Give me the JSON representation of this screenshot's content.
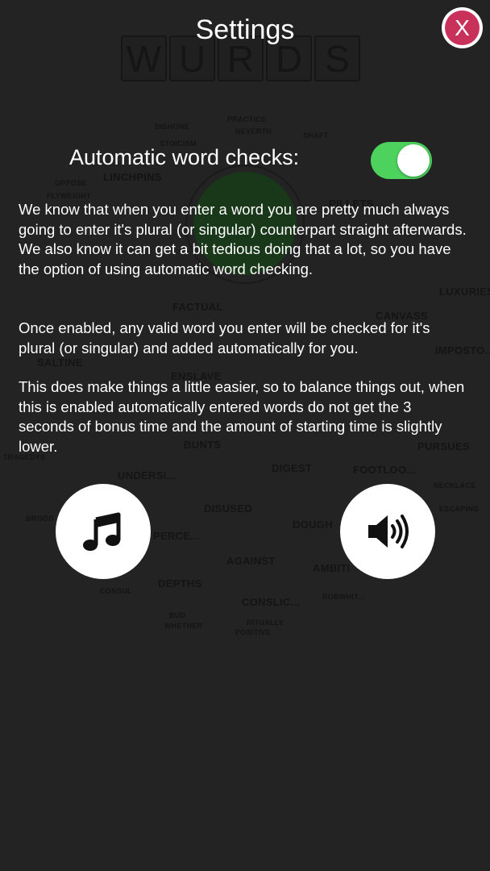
{
  "header": {
    "title": "Settings",
    "close_label": "X"
  },
  "background": {
    "logo_letters": [
      "W",
      "U",
      "R",
      "D",
      "S"
    ],
    "words": [
      "DISHONE",
      "STOICISM",
      "NEVERTH",
      "PRACTICE",
      "SHAFT",
      "LINCHPINS",
      "OPPOSE",
      "FLYWEIGHT",
      "FACTUAL",
      "ENSLAVE",
      "SALTINE",
      "TRAGEDYS",
      "BUNTS",
      "UNDERSI...",
      "DIGEST",
      "FOOTLOO...",
      "DISUSED",
      "DOUGH",
      "PERCE...",
      "AGAINST",
      "AMBITI",
      "DEPTHS",
      "CONSLIC...",
      "ROBWHIT...",
      "BUD",
      "WHETHER",
      "LUXURIES",
      "CANVASS",
      "IMPOSTO...",
      "PURSUES",
      "NECKLACE",
      "ESCAPING",
      "PILLETS",
      "BROOD",
      "RITUALLY",
      "POSITIVE",
      "CONSUL"
    ]
  },
  "settings": {
    "auto_check_label": "Automatic word checks:",
    "auto_check_enabled": true,
    "paragraphs": [
      "We know that when you enter a word you are pretty much always going to enter it's plural (or singular) counterpart straight afterwards. We also know it can get a bit tedious doing that a lot, so you have the option of using automatic word checking.",
      "Once enabled, any valid word you enter will be checked for it's plural (or singular) and added automatically for you.",
      "This does make things a little easier, so to balance things out, when this is enabled automatically entered words do not get the 3 seconds of bonus time and the amount of starting time is slightly lower."
    ]
  },
  "controls": {
    "music_icon": "music-note-icon",
    "sound_icon": "speaker-icon"
  },
  "colors": {
    "background": "#232323",
    "toggle_on": "#4dd25e",
    "close_button": "#c8325a"
  }
}
